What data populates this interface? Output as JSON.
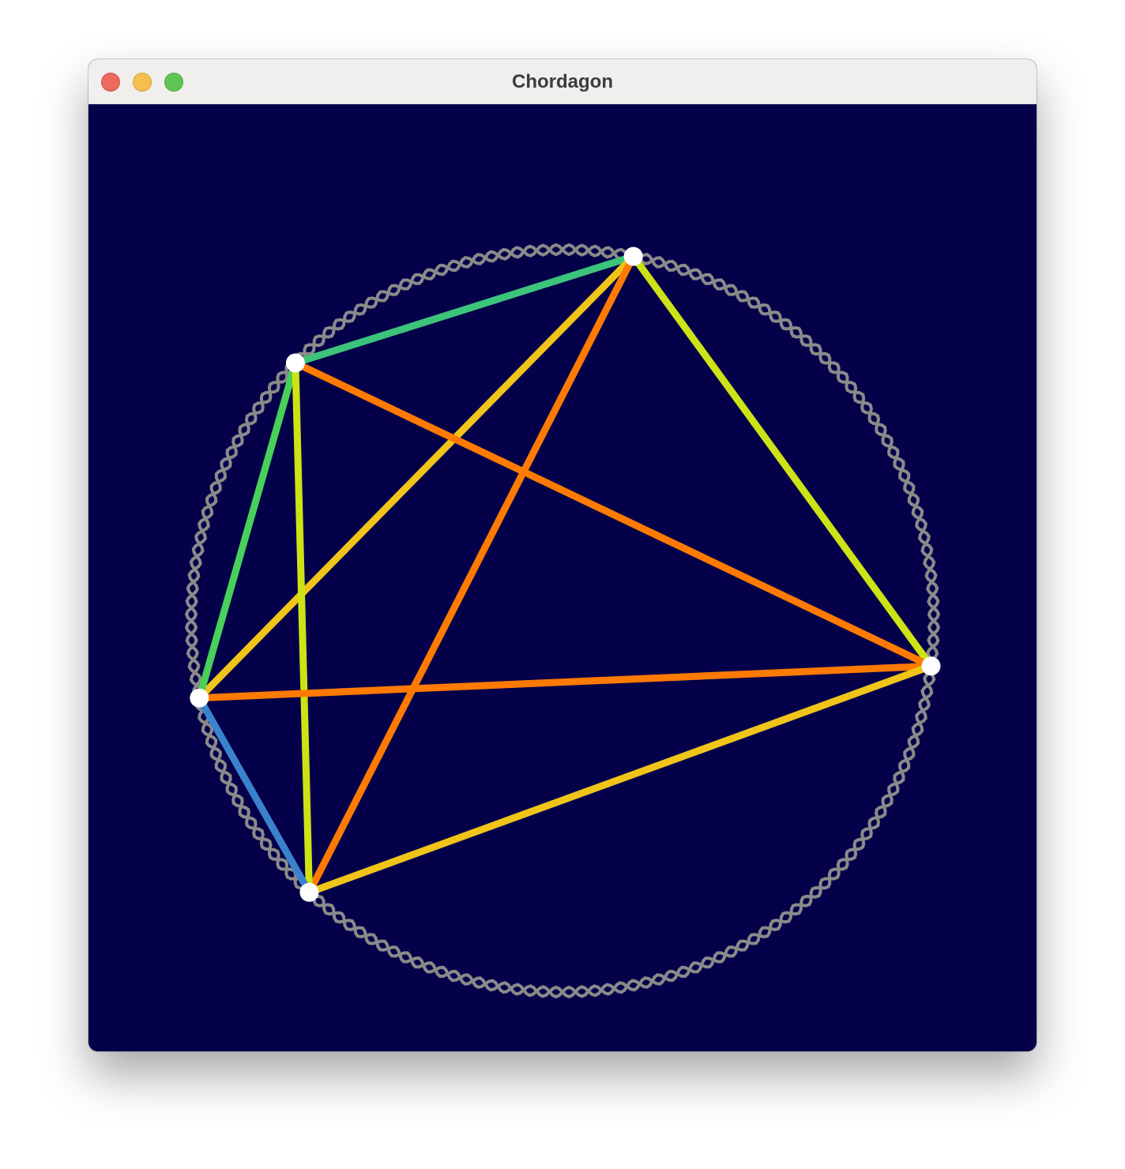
{
  "window": {
    "title": "Chordagon"
  },
  "colors": {
    "background": "#05004a",
    "titlebar": "#f0efee",
    "ring": "#8a8a8a",
    "vertex": "#ffffff"
  },
  "diagram": {
    "vertices": [
      {
        "id": "A",
        "angle_deg": -79
      },
      {
        "id": "B",
        "angle_deg": -136
      },
      {
        "id": "C",
        "angle_deg": 168
      },
      {
        "id": "D",
        "angle_deg": 133
      },
      {
        "id": "E",
        "angle_deg": 7
      }
    ],
    "edges": [
      {
        "from": "A",
        "to": "B",
        "color": "#3cc47a"
      },
      {
        "from": "A",
        "to": "C",
        "color": "#f0c419"
      },
      {
        "from": "A",
        "to": "D",
        "color": "#ff7a00"
      },
      {
        "from": "A",
        "to": "E",
        "color": "#cde315"
      },
      {
        "from": "B",
        "to": "C",
        "color": "#48d058"
      },
      {
        "from": "B",
        "to": "D",
        "color": "#cde315"
      },
      {
        "from": "B",
        "to": "E",
        "color": "#ff7a00"
      },
      {
        "from": "C",
        "to": "D",
        "color": "#3a82cc"
      },
      {
        "from": "C",
        "to": "E",
        "color": "#ff7a00"
      },
      {
        "from": "D",
        "to": "E",
        "color": "#f0c419"
      }
    ]
  }
}
